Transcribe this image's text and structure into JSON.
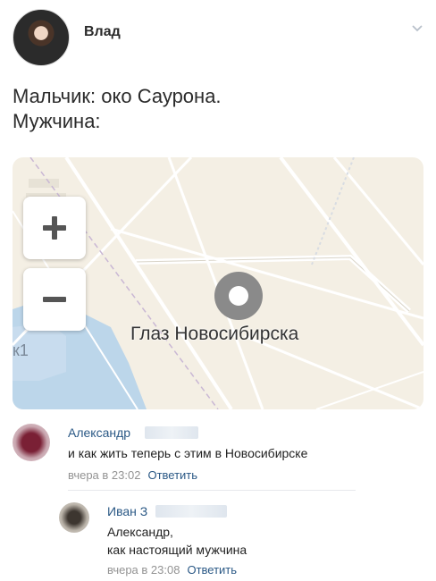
{
  "post": {
    "author": "Влад",
    "lines": [
      "Мальчик: око Саурона.",
      "Мужчина:"
    ]
  },
  "map": {
    "place_label": "Глаз Новосибирска",
    "corner_label": "к1",
    "zoom_in_symbol": "+",
    "zoom_out_symbol": "−"
  },
  "comments": [
    {
      "name": "Александр",
      "text_lines": [
        "и как жить теперь с этим в Новосибирске"
      ],
      "time": "вчера в 23:02",
      "reply_label": "Ответить"
    },
    {
      "name": "Иван З",
      "text_lines": [
        "Александр,",
        "как настоящий мужчина"
      ],
      "time": "вчера в 23:08",
      "reply_label": "Ответить"
    }
  ],
  "icons": {
    "menu": "chevron-down-icon",
    "zoom_in": "plus-icon",
    "zoom_out": "minus-icon",
    "location": "map-pin-icon"
  },
  "colors": {
    "link": "#2a5885",
    "meta": "#939393",
    "map_bg": "#f4efe4",
    "water": "#bcd6ea"
  }
}
